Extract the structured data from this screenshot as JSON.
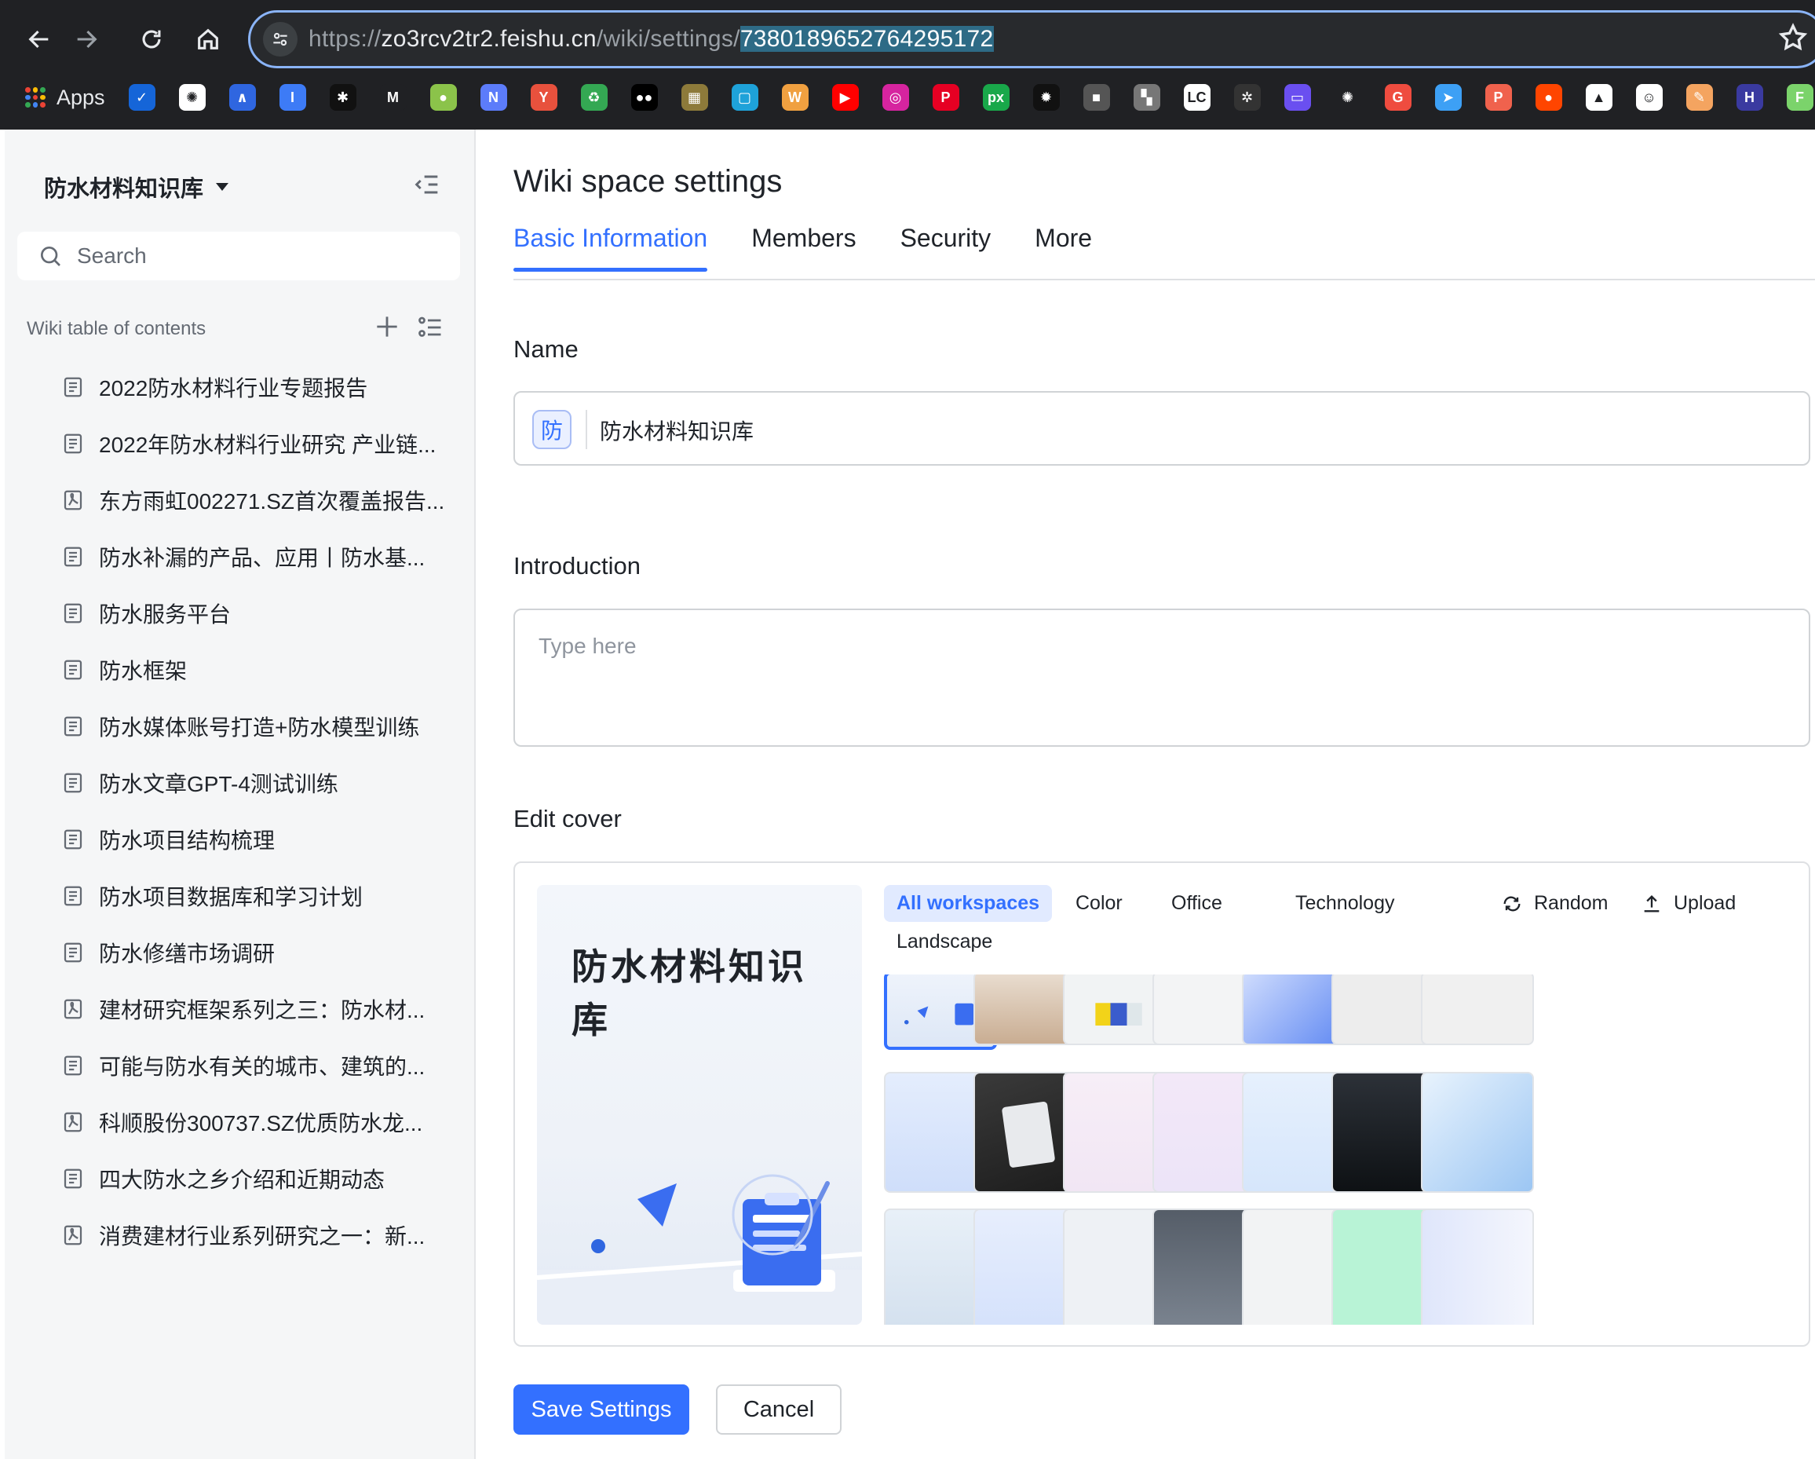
{
  "browser": {
    "url_prefix": "https://",
    "url_host": "zo3rcv2tr2.feishu.cn",
    "url_path": "/wiki/settings/",
    "url_selected": "7380189652764295172",
    "apps_label": "Apps",
    "bookmarks": [
      {
        "icon": "todo-icon",
        "color": "#1565d8",
        "glyph": "✓"
      },
      {
        "icon": "openai-icon",
        "color": "#ffffff",
        "glyph": "✺"
      },
      {
        "icon": "meta-icon",
        "color": "#2f66e0",
        "glyph": "∧"
      },
      {
        "icon": "editor-icon",
        "color": "#3d7bf6",
        "glyph": "I"
      },
      {
        "icon": "spider-icon",
        "color": "#111111",
        "glyph": "✱"
      },
      {
        "icon": "m-icon",
        "color": "#202124",
        "glyph": "M"
      },
      {
        "icon": "android-icon",
        "color": "#8bc34a",
        "glyph": "●"
      },
      {
        "icon": "n-icon",
        "color": "#5c7cfa",
        "glyph": "N"
      },
      {
        "icon": "y-icon",
        "color": "#e8513d",
        "glyph": "Y"
      },
      {
        "icon": "recycle-icon",
        "color": "#34a853",
        "glyph": "♻"
      },
      {
        "icon": "medium-icon",
        "color": "#000000",
        "glyph": "●●"
      },
      {
        "icon": "image-icon",
        "color": "#8d7a3a",
        "glyph": "▦"
      },
      {
        "icon": "bilibili-icon",
        "color": "#1ea2d9",
        "glyph": "▢"
      },
      {
        "icon": "w-icon",
        "color": "#f0a040",
        "glyph": "W"
      },
      {
        "icon": "youtube-icon",
        "color": "#ff0000",
        "glyph": "▶"
      },
      {
        "icon": "instagram-icon",
        "color": "#d6249f",
        "glyph": "◎"
      },
      {
        "icon": "pinterest-icon",
        "color": "#e60023",
        "glyph": "P"
      },
      {
        "icon": "px-icon",
        "color": "#19a84a",
        "glyph": "px"
      },
      {
        "icon": "gear-icon",
        "color": "#111111",
        "glyph": "✹"
      },
      {
        "icon": "box-icon",
        "color": "#555555",
        "glyph": "■"
      },
      {
        "icon": "puzzle-icon",
        "color": "#777777",
        "glyph": "▚"
      },
      {
        "icon": "lc-icon",
        "color": "#ffffff",
        "glyph": "LC"
      },
      {
        "icon": "compass-icon",
        "color": "#333333",
        "glyph": "✲"
      },
      {
        "icon": "chat-icon",
        "color": "#6a4ff0",
        "glyph": "▭"
      },
      {
        "icon": "openai-icon-2",
        "color": "#202124",
        "glyph": "✺"
      },
      {
        "icon": "grammarly-icon",
        "color": "#ef4c3f",
        "glyph": "G"
      },
      {
        "icon": "send-icon",
        "color": "#3da0f5",
        "glyph": "➤"
      },
      {
        "icon": "p-icon",
        "color": "#f0624d",
        "glyph": "P"
      },
      {
        "icon": "reddit-icon",
        "color": "#ff4500",
        "glyph": "●"
      },
      {
        "icon": "triangle-icon",
        "color": "#ffffff",
        "glyph": "▲"
      },
      {
        "icon": "avatar-icon",
        "color": "#ffffff",
        "glyph": "☺"
      },
      {
        "icon": "feather-icon",
        "color": "#f4a460",
        "glyph": "✎"
      },
      {
        "icon": "h-icon",
        "color": "#3a3aa0",
        "glyph": "H"
      },
      {
        "icon": "f-icon",
        "color": "#7bd36b",
        "glyph": "F"
      }
    ]
  },
  "sidebar": {
    "title": "防水材料知识库",
    "search_placeholder": "Search",
    "toc_title": "Wiki table of contents",
    "items": [
      {
        "label": "2022防水材料行业专题报告",
        "type": "doc"
      },
      {
        "label": "2022年防水材料行业研究 产业链...",
        "type": "doc"
      },
      {
        "label": "东方雨虹002271.SZ首次覆盖报告...",
        "type": "pdf"
      },
      {
        "label": "防水补漏的产品、应用丨防水基...",
        "type": "doc"
      },
      {
        "label": "防水服务平台",
        "type": "doc"
      },
      {
        "label": "防水框架",
        "type": "doc"
      },
      {
        "label": "防水媒体账号打造+防水模型训练",
        "type": "doc"
      },
      {
        "label": "防水文章GPT-4测试训练",
        "type": "doc"
      },
      {
        "label": "防水项目结构梳理",
        "type": "doc"
      },
      {
        "label": "防水项目数据库和学习计划",
        "type": "doc"
      },
      {
        "label": "防水修缮市场调研",
        "type": "doc"
      },
      {
        "label": "建材研究框架系列之三：防水材...",
        "type": "pdf"
      },
      {
        "label": "可能与防水有关的城市、建筑的...",
        "type": "doc"
      },
      {
        "label": "科顺股份300737.SZ优质防水龙...",
        "type": "pdf"
      },
      {
        "label": "四大防水之乡介绍和近期动态",
        "type": "doc"
      },
      {
        "label": "消费建材行业系列研究之一：新...",
        "type": "pdf"
      }
    ]
  },
  "main": {
    "title": "Wiki space settings",
    "tabs": [
      {
        "label": "Basic Information",
        "active": true
      },
      {
        "label": "Members",
        "active": false
      },
      {
        "label": "Security",
        "active": false
      },
      {
        "label": "More",
        "active": false
      }
    ],
    "name_label": "Name",
    "name_icon_char": "防",
    "name_value": "防水材料知识库",
    "intro_label": "Introduction",
    "intro_placeholder": "Type here",
    "cover_label": "Edit cover",
    "cover_preview_title": "防水材料知识库",
    "cover_categories": [
      "All workspaces",
      "Color",
      "Office",
      "Technology",
      "Landscape"
    ],
    "cover_random": "Random",
    "cover_upload": "Upload",
    "save_label": "Save Settings",
    "cancel_label": "Cancel"
  },
  "colors": {
    "accent": "#3370ff",
    "sidebar_bg": "#f5f6f7",
    "chrome_bg": "#202124"
  }
}
